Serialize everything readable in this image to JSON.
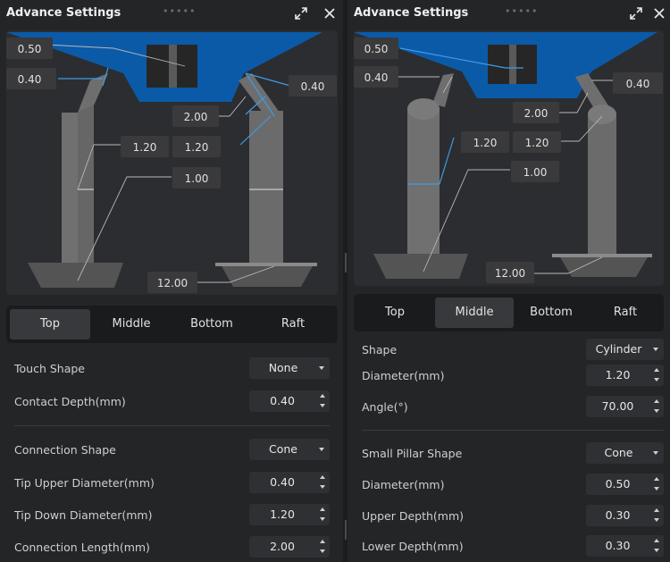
{
  "left": {
    "title": "Advance Settings",
    "grip": "•••••",
    "annotations": {
      "a050": "0.50",
      "a040l": "0.40",
      "a040r": "0.40",
      "a200": "2.00",
      "a120l": "1.20",
      "a120r": "1.20",
      "a100": "1.00",
      "a1200": "12.00"
    },
    "tabs": [
      {
        "label": "Top",
        "active": true
      },
      {
        "label": "Middle",
        "active": false
      },
      {
        "label": "Bottom",
        "active": false
      },
      {
        "label": "Raft",
        "active": false
      }
    ],
    "fields": {
      "touch_shape": {
        "label": "Touch Shape",
        "value": "None"
      },
      "contact_depth": {
        "label": "Contact Depth(mm)",
        "value": "0.40"
      },
      "connection_shape": {
        "label": "Connection Shape",
        "value": "Cone"
      },
      "tip_upper": {
        "label": "Tip Upper Diameter(mm)",
        "value": "0.40"
      },
      "tip_down": {
        "label": "Tip Down Diameter(mm)",
        "value": "1.20"
      },
      "connection_length": {
        "label": "Connection Length(mm)",
        "value": "2.00"
      }
    }
  },
  "right": {
    "title": "Advance Settings",
    "grip": "•••••",
    "annotations": {
      "a050": "0.50",
      "a040l": "0.40",
      "a040r": "0.40",
      "a200": "2.00",
      "a120l": "1.20",
      "a120r": "1.20",
      "a100": "1.00",
      "a1200": "12.00"
    },
    "tabs": [
      {
        "label": "Top",
        "active": false
      },
      {
        "label": "Middle",
        "active": true
      },
      {
        "label": "Bottom",
        "active": false
      },
      {
        "label": "Raft",
        "active": false
      }
    ],
    "fields": {
      "shape": {
        "label": "Shape",
        "value": "Cylinder"
      },
      "diameter": {
        "label": "Diameter(mm)",
        "value": "1.20"
      },
      "angle": {
        "label": "Angle(°)",
        "value": "70.00"
      },
      "small_pillar_shape": {
        "label": "Small Pillar Shape",
        "value": "Cone"
      },
      "small_diameter": {
        "label": "Diameter(mm)",
        "value": "0.50"
      },
      "upper_depth": {
        "label": "Upper Depth(mm)",
        "value": "0.30"
      },
      "lower_depth": {
        "label": "Lower Depth(mm)",
        "value": "0.30"
      }
    }
  },
  "colors": {
    "model_blue": "#0b5aa8",
    "accent_line": "#3f9be6",
    "pillar": "#707070"
  },
  "icons": {
    "expand": "expand-icon",
    "close": "close-icon"
  }
}
